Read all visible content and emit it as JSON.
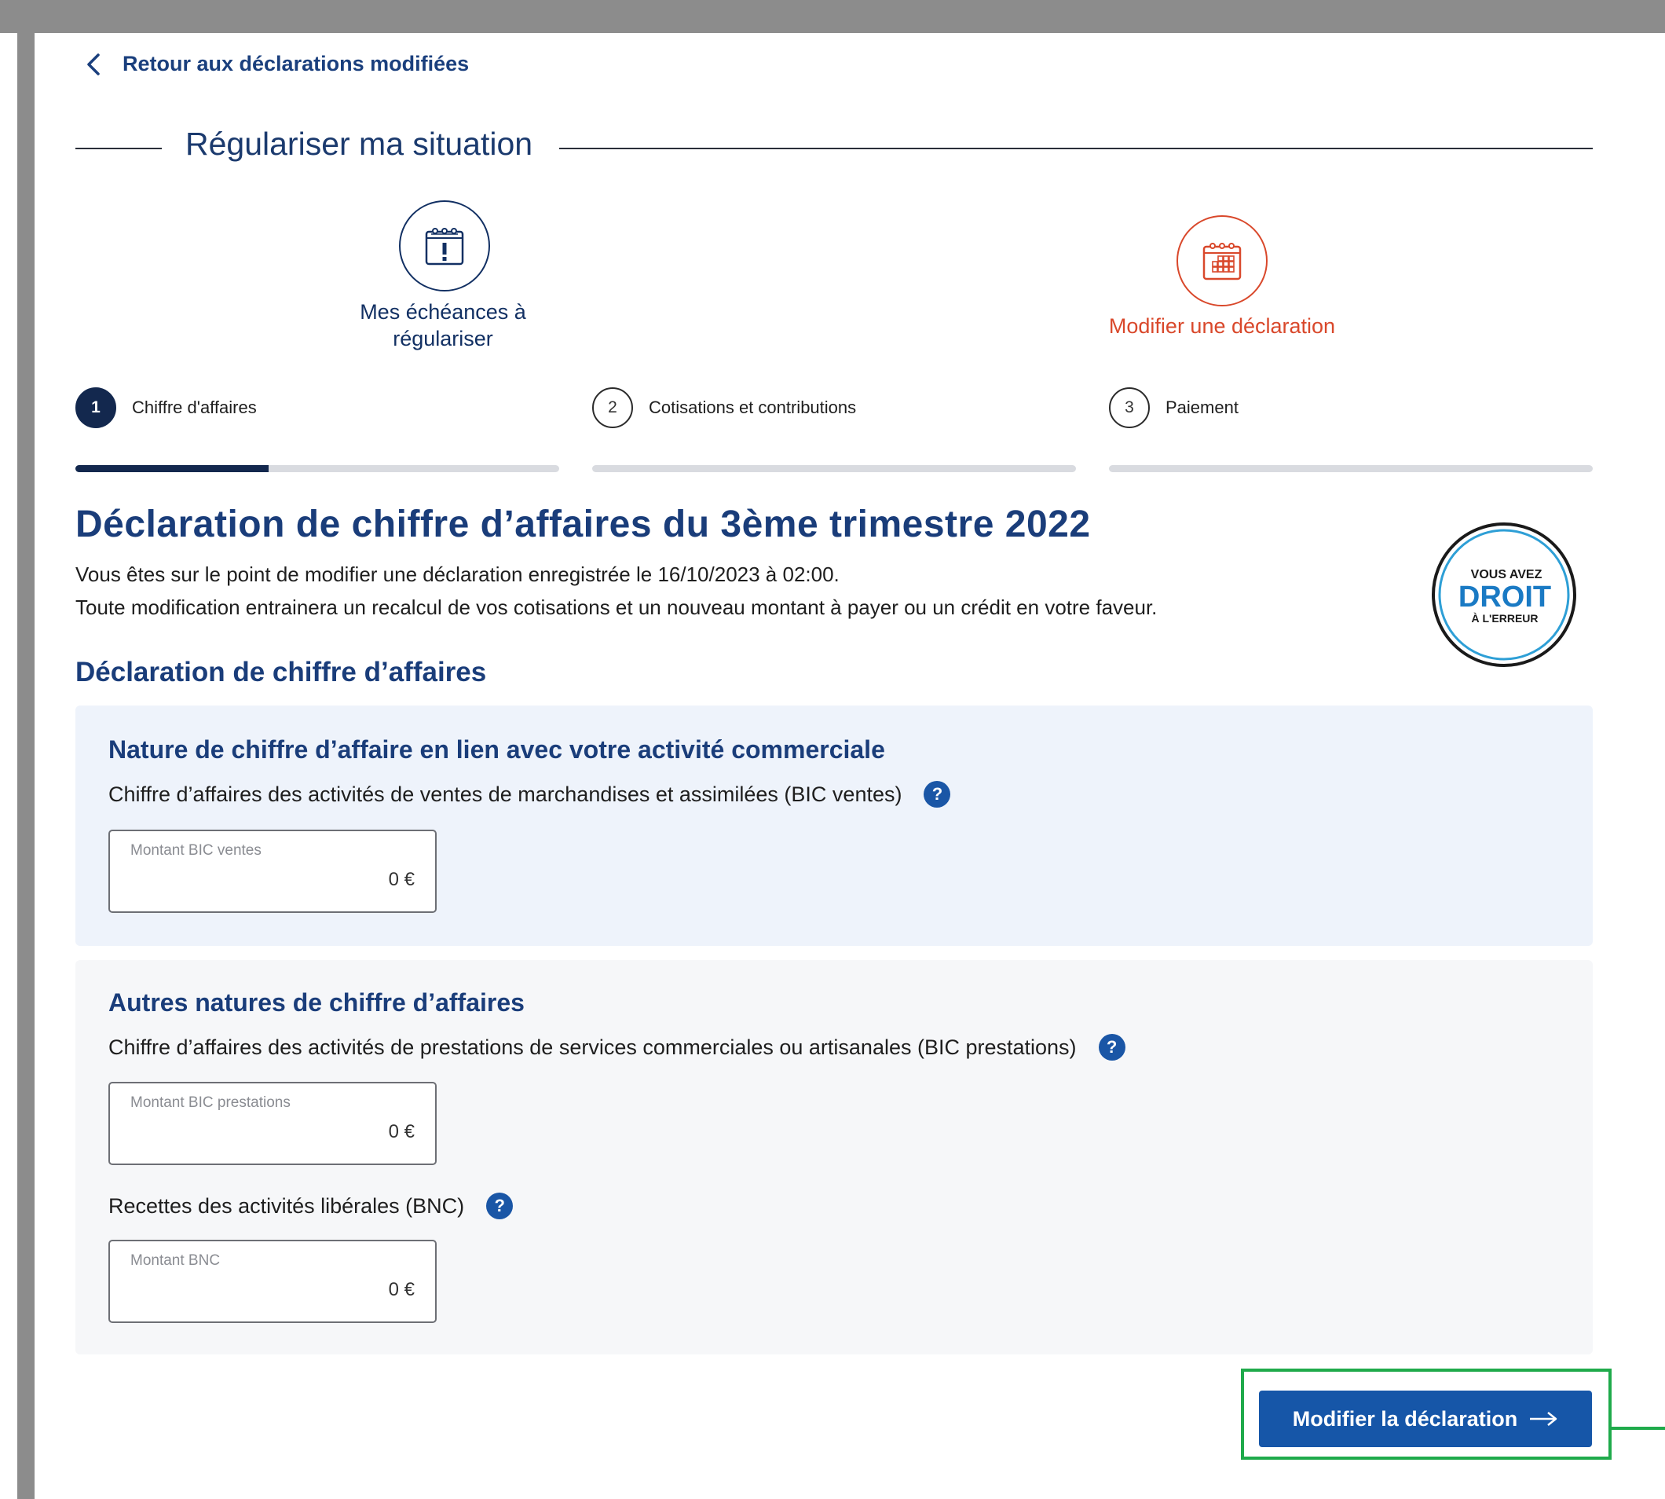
{
  "back_link": {
    "label": "Retour aux déclarations modifiées"
  },
  "section": {
    "title": "Régulariser ma situation"
  },
  "journey": [
    {
      "label": "Mes échéances à régulariser",
      "icon": "calendar-alert-icon",
      "color": "#123063"
    },
    {
      "label": "Modifier une déclaration",
      "icon": "calendar-grid-icon",
      "color": "#d9482b"
    }
  ],
  "steps": [
    {
      "number": "1",
      "label": "Chiffre d'affaires",
      "active": true,
      "progress": 0.4
    },
    {
      "number": "2",
      "label": "Cotisations et contributions",
      "active": false,
      "progress": 0
    },
    {
      "number": "3",
      "label": "Paiement",
      "active": false,
      "progress": 0
    }
  ],
  "main": {
    "title": "Déclaration de chiffre d’affaires du 3ème trimestre 2022",
    "intro_line1": "Vous êtes sur le point de modifier une déclaration enregistrée le 16/10/2023 à 02:00.",
    "intro_line2": "Toute modification entrainera un recalcul de vos cotisations et un nouveau montant à payer ou un crédit en votre faveur.",
    "subtitle": "Déclaration de chiffre d’affaires"
  },
  "badge": {
    "line1": "VOUS AVEZ",
    "line2": "DROIT",
    "line3": "À L'ERREUR"
  },
  "card_commercial": {
    "title": "Nature de chiffre d’affaire en lien avec votre activité commerciale",
    "field_label": "Chiffre d’affaires des activités de ventes de marchandises et assimilées (BIC ventes)",
    "placeholder": "Montant BIC ventes",
    "value": "0 €"
  },
  "card_other": {
    "title": "Autres natures de chiffre d’affaires",
    "bic_label": "Chiffre d’affaires des activités de prestations de services commerciales ou artisanales (BIC prestations)",
    "bic_placeholder": "Montant BIC prestations",
    "bic_value": "0 €",
    "bnc_label": "Recettes des activités libérales (BNC)",
    "bnc_placeholder": "Montant BNC",
    "bnc_value": "0 €"
  },
  "help_glyph": "?",
  "submit": {
    "label": "Modifier la déclaration"
  },
  "colors": {
    "primary": "#1656a8",
    "navy": "#13284e",
    "accent_orange": "#d9482b",
    "highlight": "#1faa4b"
  }
}
